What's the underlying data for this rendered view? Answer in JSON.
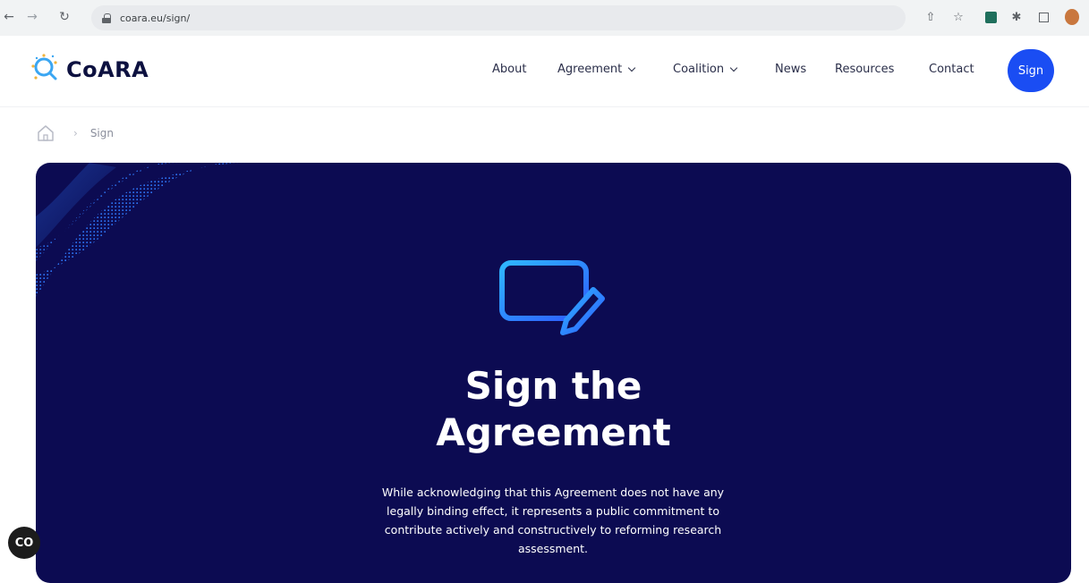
{
  "browser": {
    "url": "coara.eu/sign/"
  },
  "header": {
    "logo_text": "CoARA",
    "nav": [
      {
        "label": "About"
      },
      {
        "label": "Agreement"
      },
      {
        "label": "Coalition"
      },
      {
        "label": "News"
      },
      {
        "label": "Resources"
      },
      {
        "label": "Contact"
      }
    ],
    "sign_label": "Sign"
  },
  "breadcrumb": {
    "current": "Sign"
  },
  "hero": {
    "title_line1": "Sign the",
    "title_line2": "Agreement",
    "description": "While acknowledging that this Agreement does not have any legally binding effect, it represents a public commitment to contribute actively and constructively to reforming research assessment."
  },
  "badge": {
    "label": "CO"
  },
  "colors": {
    "accent": "#1a4df3",
    "hero_bg": "#0c0b52",
    "brand_text": "#0d1140"
  }
}
